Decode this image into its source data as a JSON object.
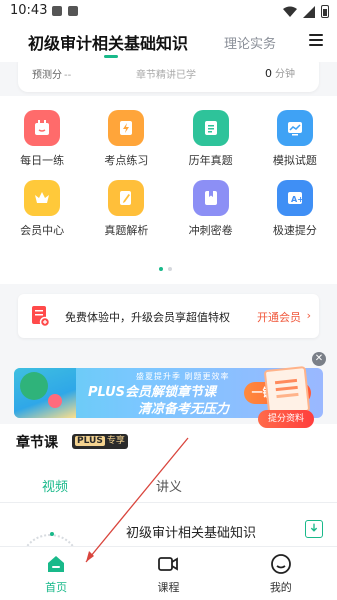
{
  "status_bar": {
    "time": "10:43"
  },
  "header": {
    "active_tab": "初级审计相关基础知识",
    "other_tab": "理论实务"
  },
  "top_card": {
    "stat1_label": "预测分",
    "stat1_value": "--",
    "stat2_label": "章节精讲已学",
    "stat3_value": "0",
    "stat3_unit": "分钟"
  },
  "grid": {
    "items": [
      {
        "label": "每日一练",
        "icon": "calendar-icon",
        "color": "#ff6b6b"
      },
      {
        "label": "考点练习",
        "icon": "lightning-icon",
        "color": "#ffa53a"
      },
      {
        "label": "历年真题",
        "icon": "document-icon",
        "color": "#2ec39a"
      },
      {
        "label": "模拟试题",
        "icon": "chart-icon",
        "color": "#3fa2f5"
      },
      {
        "label": "会员中心",
        "icon": "crown-icon",
        "color": "#ffc93a"
      },
      {
        "label": "真题解析",
        "icon": "pencil-icon",
        "color": "#ffbf3a"
      },
      {
        "label": "冲刺密卷",
        "icon": "book-icon",
        "color": "#8c8ff5"
      },
      {
        "label": "极速提分",
        "icon": "boost-icon",
        "color": "#3f8ff5"
      }
    ]
  },
  "vip_banner": {
    "text": "免费体验中，升级会员享超值特权",
    "link": "开通会员"
  },
  "promo": {
    "small_text": "盛夏提升季 刷题更效率",
    "title": "PLUS会员解锁章节课",
    "subtitle": "清凉备考无压力",
    "cta": "一键抢GO"
  },
  "float_promo": {
    "label": "提分资料"
  },
  "course_section": {
    "title": "章节课",
    "badge_plus": "PLUS",
    "badge_text": "专享",
    "tabs": [
      "视频",
      "讲义"
    ],
    "course_name": "初级审计相关基础知识"
  },
  "bottom_nav": {
    "items": [
      {
        "label": "首页",
        "icon": "home-icon"
      },
      {
        "label": "课程",
        "icon": "video-camera-icon"
      },
      {
        "label": "我的",
        "icon": "smiley-icon"
      }
    ]
  },
  "colors": {
    "accent": "#19b98a",
    "vip_link": "#f0583c",
    "annotation_arrow": "#d9453d"
  }
}
